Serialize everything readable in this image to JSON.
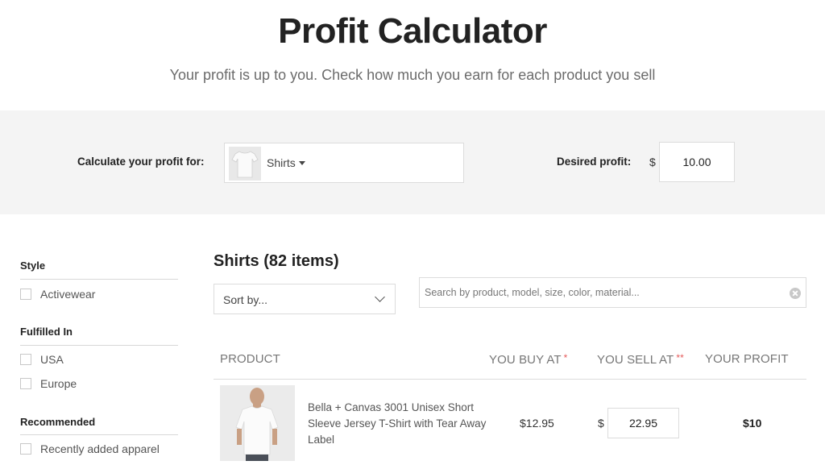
{
  "hero": {
    "title": "Profit Calculator",
    "subtitle": "Your profit is up to you. Check how much you earn for each product you sell"
  },
  "calculator": {
    "for_label": "Calculate your profit for:",
    "product_selected": "Shirts",
    "desired_label": "Desired profit:",
    "currency": "$",
    "desired_value": "10.00"
  },
  "sidebar": {
    "groups": [
      {
        "title": "Style",
        "options": [
          "Activewear"
        ]
      },
      {
        "title": "Fulfilled In",
        "options": [
          "USA",
          "Europe"
        ]
      },
      {
        "title": "Recommended",
        "options": [
          "Recently added apparel"
        ]
      }
    ]
  },
  "listing": {
    "title": "Shirts (82 items)",
    "sort_label": "Sort by...",
    "search_placeholder": "Search by product, model, size, color, material..."
  },
  "table": {
    "headers": {
      "product": "PRODUCT",
      "buy": "YOU BUY AT",
      "buy_mark": "*",
      "sell": "YOU SELL AT",
      "sell_mark": "**",
      "profit": "YOUR PROFIT"
    },
    "rows": [
      {
        "name": "Bella + Canvas 3001 Unisex Short Sleeve Jersey T-Shirt with Tear Away Label",
        "buy_price": "$12.95",
        "currency": "$",
        "sell_price": "22.95",
        "profit": "$10"
      }
    ]
  },
  "colors": {
    "band_bg": "#f4f4f4",
    "required_mark": "#e55a5a"
  }
}
